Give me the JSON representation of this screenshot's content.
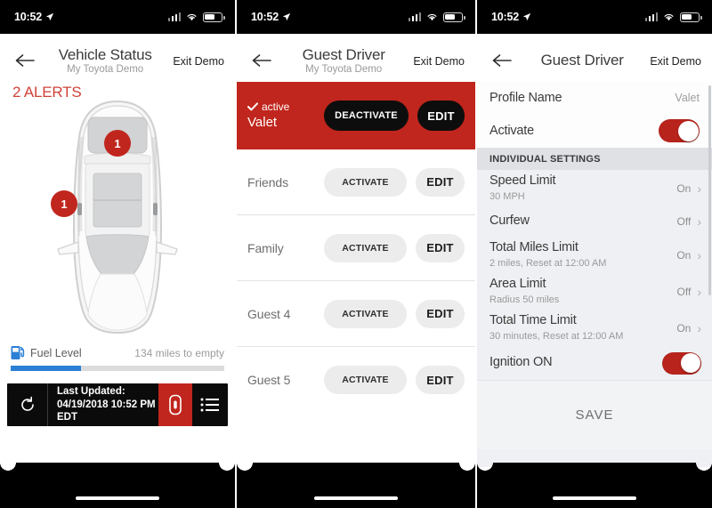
{
  "status_bar": {
    "time": "10:52",
    "location_icon": "location-arrow-icon",
    "signal_icon": "cellular-signal-icon",
    "wifi_icon": "wifi-icon",
    "battery_icon": "battery-icon"
  },
  "panel1": {
    "nav": {
      "back_icon": "back-arrow-icon",
      "title": "Vehicle Status",
      "subtitle": "My Toyota Demo",
      "exit_label": "Exit Demo"
    },
    "alerts_label": "2 ALERTS",
    "car_diagram": {
      "name": "vehicle-top-view-diagram",
      "badges": [
        {
          "label": "1",
          "position": "trunk"
        },
        {
          "label": "1",
          "position": "driver-front-door"
        }
      ]
    },
    "fuel": {
      "icon": "fuel-pump-icon",
      "label": "Fuel Level",
      "range_text": "134 miles to empty",
      "percent": 33,
      "fill_color": "#2b7fd4"
    },
    "bottom_bar": {
      "refresh_icon": "refresh-icon",
      "last_updated_label": "Last Updated:",
      "last_updated_value": "04/19/2018 10:52 PM EDT",
      "car_icon": "car-lock-icon",
      "menu_icon": "list-menu-icon",
      "accent_color": "#c0261d"
    }
  },
  "panel2": {
    "nav": {
      "back_icon": "back-arrow-icon",
      "title": "Guest Driver",
      "subtitle": "My Toyota Demo",
      "exit_label": "Exit Demo"
    },
    "active_profile": {
      "check_icon": "check-icon",
      "status_label": "active",
      "name": "Valet",
      "deactivate_label": "DEACTIVATE",
      "edit_label": "EDIT",
      "background_color": "#c0261d"
    },
    "profiles": [
      {
        "name": "Friends",
        "activate_label": "ACTIVATE",
        "edit_label": "EDIT"
      },
      {
        "name": "Family",
        "activate_label": "ACTIVATE",
        "edit_label": "EDIT"
      },
      {
        "name": "Guest 4",
        "activate_label": "ACTIVATE",
        "edit_label": "EDIT"
      },
      {
        "name": "Guest 5",
        "activate_label": "ACTIVATE",
        "edit_label": "EDIT"
      }
    ]
  },
  "panel3": {
    "nav": {
      "back_icon": "back-arrow-icon",
      "title": "Guest Driver",
      "exit_label": "Exit Demo"
    },
    "profile_name": {
      "label": "Profile Name",
      "value": "Valet"
    },
    "activate": {
      "label": "Activate",
      "toggle_on": true,
      "toggle_color": "#b8241c"
    },
    "section_header": "INDIVIDUAL SETTINGS",
    "settings": [
      {
        "title": "Speed Limit",
        "subtitle": "30 MPH",
        "state": "On",
        "chevron": "chevron-right-icon"
      },
      {
        "title": "Curfew",
        "subtitle": "",
        "state": "Off",
        "chevron": "chevron-right-icon"
      },
      {
        "title": "Total Miles Limit",
        "subtitle": "2 miles, Reset at 12:00 AM",
        "state": "On",
        "chevron": "chevron-right-icon"
      },
      {
        "title": "Area Limit",
        "subtitle": "Radius 50 miles",
        "state": "Off",
        "chevron": "chevron-right-icon"
      },
      {
        "title": "Total Time Limit",
        "subtitle": "30 minutes, Reset at 12:00 AM",
        "state": "On",
        "chevron": "chevron-right-icon"
      }
    ],
    "ignition": {
      "label": "Ignition ON",
      "toggle_on": true
    },
    "save_label": "SAVE"
  }
}
